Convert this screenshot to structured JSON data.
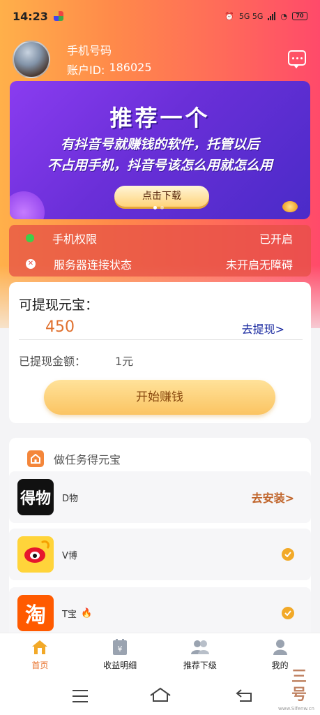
{
  "status_bar": {
    "time": "14:23",
    "right_text": "5G 5G",
    "battery": "70"
  },
  "profile": {
    "name": "手机号码",
    "id_label": "账户ID:",
    "id_value": "186025"
  },
  "banner": {
    "title": "推荐一个",
    "line1": "有抖音号就赚钱的软件，托管以后",
    "line2": "不占用手机，抖音号该怎么用就怎么用",
    "button": "点击下载",
    "dots": 2,
    "active_dot": 0,
    "colors": {
      "start": "#8a3cf0",
      "end": "#4a2bc8"
    }
  },
  "status": {
    "permission_label": "手机权限",
    "permission_value": "已开启",
    "server_label": "服务器连接状态",
    "server_value": "未开启无障碍"
  },
  "wallet": {
    "title": "可提现元宝：",
    "amount": "450",
    "withdraw_link": "去提现>",
    "withdrawn_label": "已提现金额：",
    "withdrawn_value": "1元",
    "earn_button": "开始赚钱"
  },
  "tasks": {
    "title": "做任务得元宝",
    "items": [
      {
        "icon": "dewu-app-icon",
        "icon_text": "得物",
        "name": "D物",
        "action": "去安装>",
        "done": false
      },
      {
        "icon": "weibo-app-icon",
        "name": "V博",
        "done": true
      },
      {
        "icon": "taobao-app-icon",
        "icon_text": "淘",
        "name": "T宝",
        "hot": true,
        "done": true
      }
    ]
  },
  "tabbar": {
    "tabs": [
      {
        "label": "首页",
        "icon": "home-icon",
        "active": true
      },
      {
        "label": "收益明细",
        "icon": "income-icon",
        "active": false
      },
      {
        "label": "推荐下级",
        "icon": "people-icon",
        "active": false
      },
      {
        "label": "我的",
        "icon": "user-icon",
        "active": false
      }
    ]
  },
  "watermark": {
    "text": "三号",
    "url": "www.Sifenw.cn"
  },
  "colors": {
    "accent": "#e8702a",
    "link": "#1a2aa0",
    "status_ok": "#3ecf4a",
    "check": "#f2a928"
  }
}
